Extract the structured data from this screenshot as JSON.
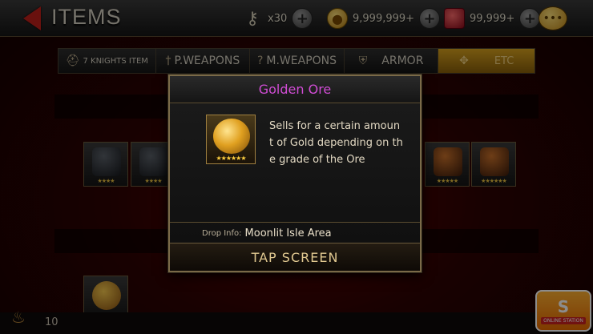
{
  "header": {
    "title": "ITEMS",
    "resources": {
      "keys": "x30",
      "gold": "9,999,999+",
      "rubies": "99,999+"
    }
  },
  "tabs": [
    {
      "label": "7 KNIGHTS ITEM",
      "icon": "helmet-icon"
    },
    {
      "label": "P.WEAPONS",
      "icon": "sword-icon"
    },
    {
      "label": "M.WEAPONS",
      "icon": "staff-icon"
    },
    {
      "label": "ARMOR",
      "icon": "shield-icon"
    },
    {
      "label": "ETC",
      "icon": "cross-icon",
      "active": true
    }
  ],
  "modal": {
    "title": "Golden Ore",
    "description": "Sells for a certain amount of Gold depending on the grade of the Ore",
    "drop_label": "Drop Info:",
    "drop_value": "Moonlit Isle Area",
    "tap_label": "TAP SCREEN",
    "title_color": "#d04cd4"
  },
  "footer": {
    "count": "10",
    "watermark_big": "S",
    "watermark_small": "ONLINE STATION"
  }
}
